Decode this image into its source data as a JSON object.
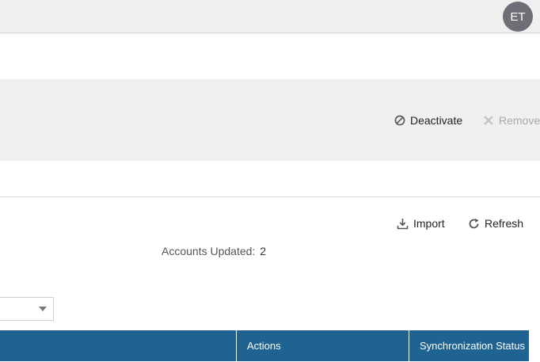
{
  "header": {
    "user_initials": "ET"
  },
  "actions": {
    "deactivate": {
      "label": "Deactivate",
      "icon": "ban-icon"
    },
    "remove": {
      "label": "Remove",
      "icon": "close-icon",
      "disabled": true
    }
  },
  "toolbar": {
    "import": {
      "label": "Import",
      "icon": "download-icon"
    },
    "refresh": {
      "label": "Refresh",
      "icon": "refresh-icon"
    }
  },
  "summary": {
    "accounts_updated_label": "Accounts Updated:",
    "accounts_updated_value": "2"
  },
  "filter": {
    "selected": ""
  },
  "table": {
    "columns": [
      "",
      "Actions",
      "Synchronization Status"
    ]
  },
  "colors": {
    "table_header": "#1f6392",
    "top_bar": "#efefef",
    "action_band": "#f0f0f0",
    "avatar": "#6e6e76",
    "disabled_text": "#a8a8a8"
  }
}
